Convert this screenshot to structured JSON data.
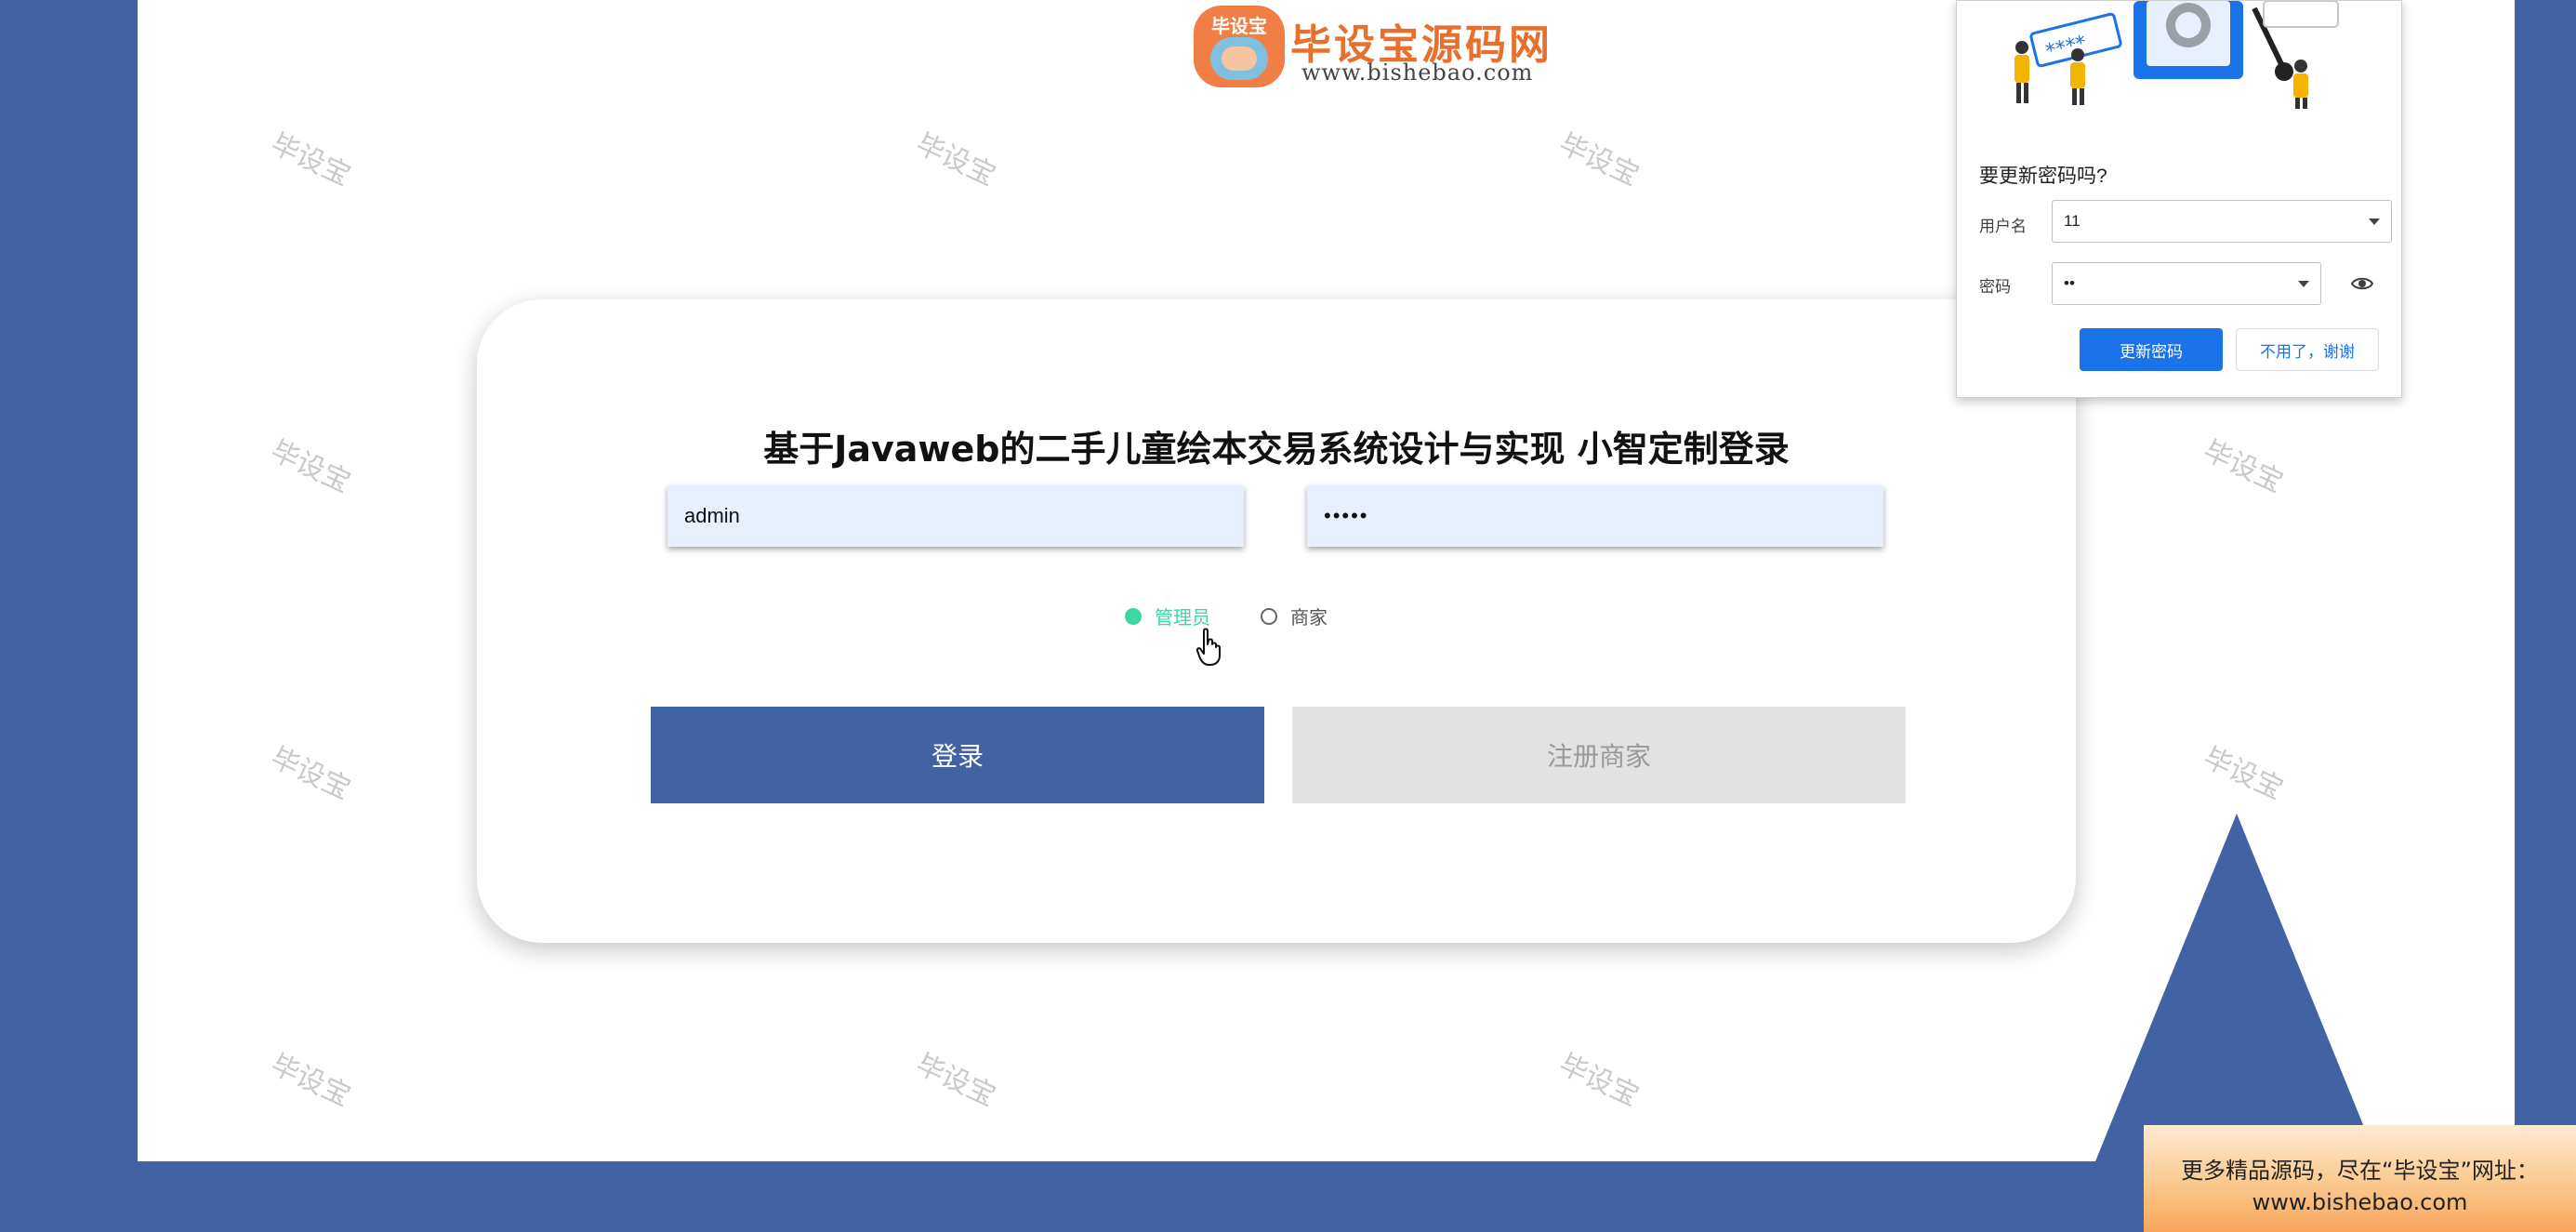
{
  "site": {
    "logo_mark": "毕设宝",
    "logo_title": "毕设宝源码网",
    "logo_url": "www.bishebao.com"
  },
  "watermark": "毕设宝",
  "login": {
    "title": "基于Javaweb的二手儿童绘本交易系统设计与实现 小智定制登录",
    "username_value": "admin",
    "password_value": "•••••",
    "roles": [
      "管理员",
      "商家"
    ],
    "selected_role": "管理员",
    "login_button": "登录",
    "register_button": "注册商家"
  },
  "password_popup": {
    "title": "要更新密码吗?",
    "username_label": "用户名",
    "username_value": "11",
    "password_label": "密码",
    "password_value": "••",
    "update_button": "更新密码",
    "dismiss_button": "不用了，谢谢",
    "illustration_text": "****"
  },
  "promo": {
    "line1": "更多精品源码，尽在“毕设宝”网址：",
    "line2": "www.bishebao.com"
  },
  "colors": {
    "background_blue": "#4263a3",
    "accent_green": "#3fd7a1",
    "chrome_blue": "#1a73e8",
    "logo_orange": "#e8702f"
  }
}
